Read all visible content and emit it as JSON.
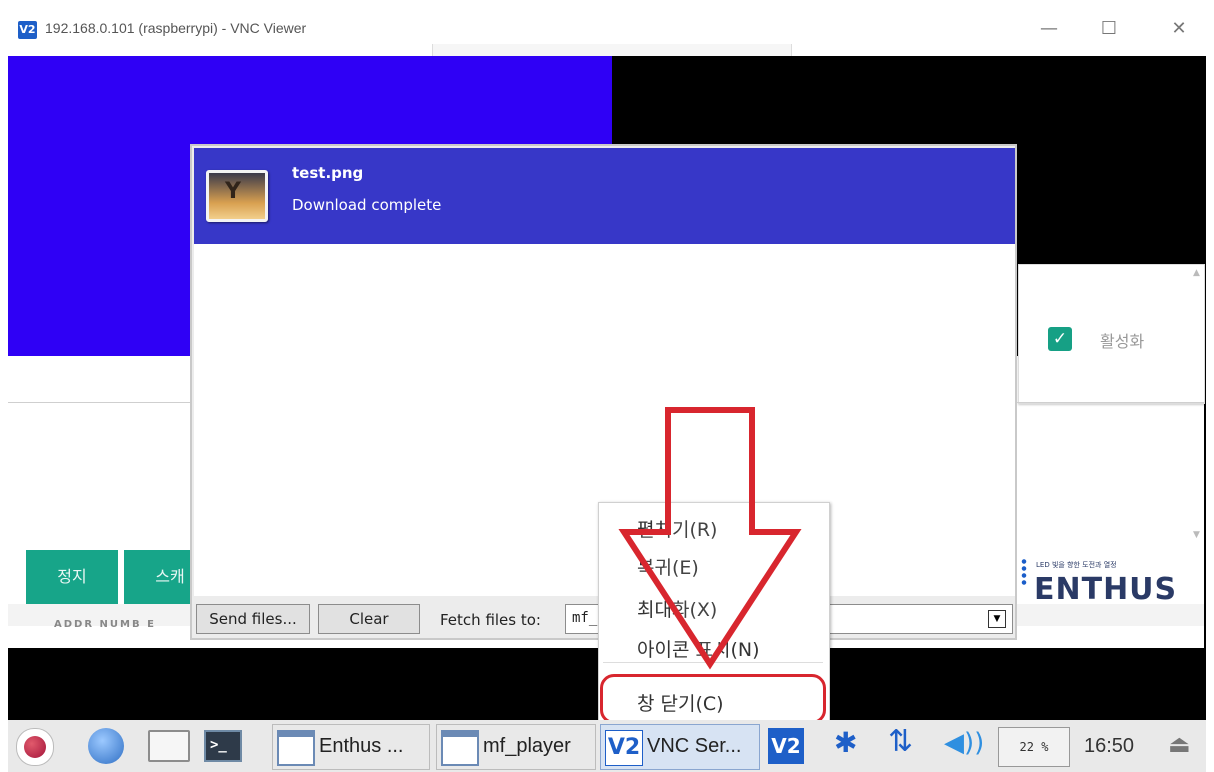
{
  "window": {
    "logo": "V2",
    "title": "192.168.0.101 (raspberrypi) - VNC Viewer",
    "minimize": "—",
    "maximize": "☐",
    "close": "✕"
  },
  "app_panel": {
    "activate_label": "활성화",
    "activate_checked": true,
    "buttons": [
      "정지",
      "스캐"
    ],
    "strip_text": "ADDR  NUMB  E",
    "brand_tagline": "LED 빛을 향한 도전과 열정",
    "brand_name": "ENTHUS",
    "accent_color": "#17a589"
  },
  "file_transfer": {
    "file_name": "test.png",
    "file_status": "Download complete",
    "file_icon": "image-file-icon",
    "send_button": "Send files...",
    "clear_button": "Clear",
    "fetch_label": "Fetch files to:",
    "fetch_value": "mf_",
    "dropdown_glyph": "▼",
    "selected_row_color": "#3737c8"
  },
  "context_menu": {
    "items": [
      "펼치기(R)",
      "복귀(E)",
      "최대화(X)",
      "아이콘 표시(N)",
      "창 닫기(C)"
    ],
    "annotation_color": "#d8262e"
  },
  "taskbar": {
    "tasks": [
      "Enthus ...",
      "mf_player",
      "VNC Ser..."
    ],
    "cpu_meter": "22 %",
    "clock": "16:50",
    "terminal_glyph": ">_",
    "vnc_tray_logo": "V2",
    "bluetooth_glyph": "✱",
    "network_glyph": "⇅",
    "volume_glyph": "◀))",
    "eject_glyph": "⏏"
  }
}
